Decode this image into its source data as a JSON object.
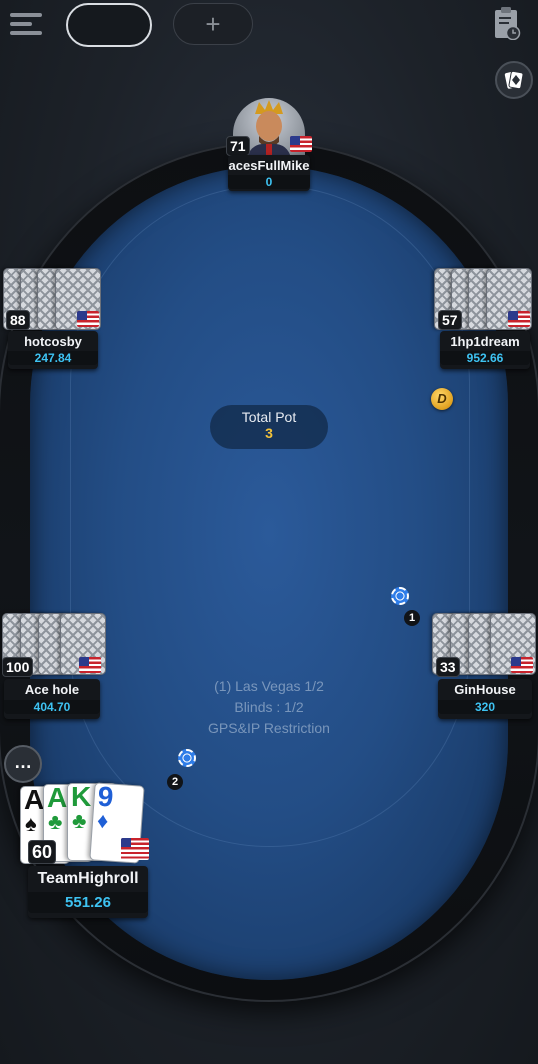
{
  "toolbar": {
    "menu_icon": "hamburger-menu-icon",
    "add_table_label": "+",
    "clipboard_icon": "clipboard-clock-icon",
    "deck_icon": "card-deck-icon"
  },
  "pot": {
    "label": "Total Pot",
    "value": "3"
  },
  "table_info": {
    "name": "(1) Las Vegas 1/2",
    "blinds": "Blinds : 1/2",
    "restriction": "GPS&IP Restriction"
  },
  "players": {
    "top": {
      "name": "acesFullMike",
      "stack": "0",
      "level": "71"
    },
    "left_top": {
      "name": "hotcosby",
      "stack": "247.84",
      "level": "88"
    },
    "right_top": {
      "name": "1hp1dream",
      "stack": "952.66",
      "level": "57"
    },
    "left_bottom": {
      "name": "Ace hole",
      "stack": "404.70",
      "level": "100"
    },
    "right_bottom": {
      "name": "GinHouse",
      "stack": "320",
      "level": "33"
    },
    "hero": {
      "name": "TeamHighroll",
      "stack": "551.26",
      "level": "60"
    }
  },
  "hero_cards": [
    {
      "rank": "A",
      "suit": "♠",
      "color": "#111111"
    },
    {
      "rank": "A",
      "suit": "♣",
      "color": "#1f9a3a"
    },
    {
      "rank": "K",
      "suit": "♣",
      "color": "#1f9a3a"
    },
    {
      "rank": "9",
      "suit": "♦",
      "color": "#1f5fd6"
    }
  ],
  "bets": {
    "right": "1",
    "hero": "2"
  },
  "dealer_label": "D",
  "chat_icon": "chat-bubble-icon"
}
